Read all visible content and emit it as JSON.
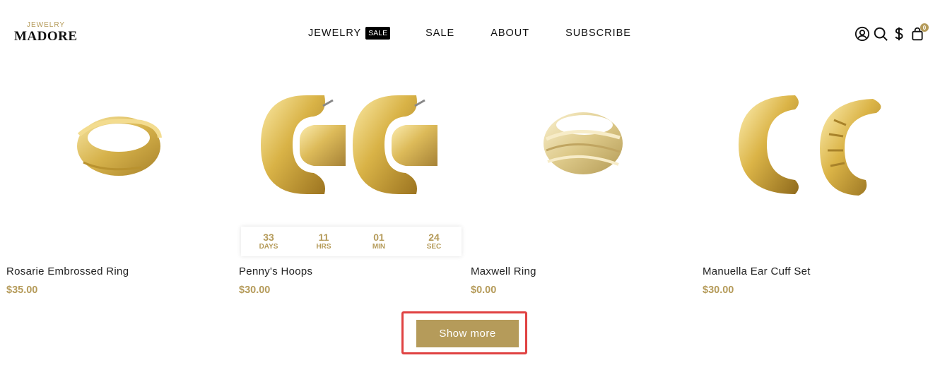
{
  "header": {
    "logo_top": "JEWELRY",
    "logo_main": "MADORE",
    "nav": [
      {
        "label": "JEWELRY",
        "badge": "SALE"
      },
      {
        "label": "SALE"
      },
      {
        "label": "ABOUT"
      },
      {
        "label": "SUBSCRIBE"
      }
    ],
    "icons": [
      "account-icon",
      "search-icon",
      "currency-icon",
      "cart-icon"
    ],
    "cart_count": "0"
  },
  "products": [
    {
      "name": "Rosarie Embrossed Ring",
      "price": "$35.00",
      "image": "ring-icon"
    },
    {
      "name": "Penny's Hoops",
      "price": "$30.00",
      "image": "hoop-earrings-icon",
      "countdown": [
        {
          "value": "33",
          "unit": "DAYS"
        },
        {
          "value": "11",
          "unit": "HRS"
        },
        {
          "value": "01",
          "unit": "MIN"
        },
        {
          "value": "24",
          "unit": "SEC"
        }
      ]
    },
    {
      "name": "Maxwell Ring",
      "price": "$0.00",
      "image": "ring-icon"
    },
    {
      "name": "Manuella Ear Cuff Set",
      "price": "$30.00",
      "image": "ear-cuff-icon"
    }
  ],
  "show_more_label": "Show more",
  "colors": {
    "accent": "#b59b5a",
    "highlight": "#e04242",
    "gold": "#d4b24a"
  }
}
